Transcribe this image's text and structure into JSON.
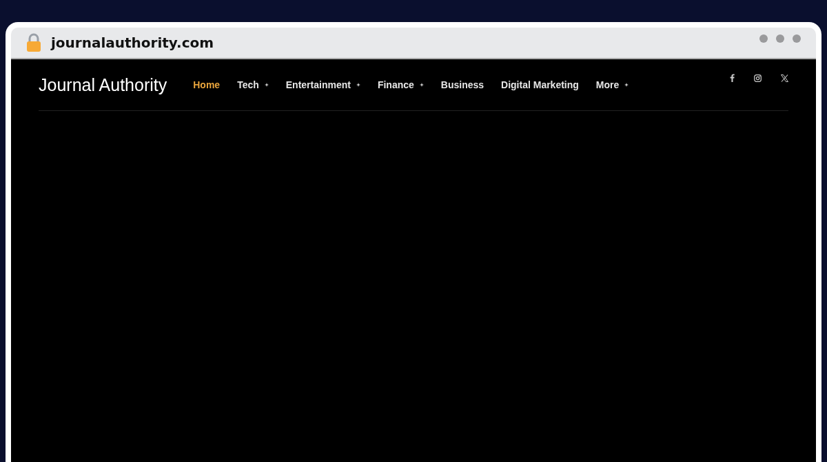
{
  "browser": {
    "url": "journalauthority.com"
  },
  "site": {
    "title": "Journal Authority",
    "nav": [
      {
        "label": "Home",
        "selected": true,
        "has_dropdown": false
      },
      {
        "label": "Tech",
        "selected": false,
        "has_dropdown": true
      },
      {
        "label": "Entertainment",
        "selected": false,
        "has_dropdown": true
      },
      {
        "label": "Finance",
        "selected": false,
        "has_dropdown": true
      },
      {
        "label": "Business",
        "selected": false,
        "has_dropdown": false
      },
      {
        "label": "Digital Marketing",
        "selected": false,
        "has_dropdown": false
      },
      {
        "label": "More",
        "selected": false,
        "has_dropdown": true
      }
    ],
    "social": [
      {
        "kind": "facebook"
      },
      {
        "kind": "instagram"
      },
      {
        "kind": "x"
      }
    ]
  }
}
